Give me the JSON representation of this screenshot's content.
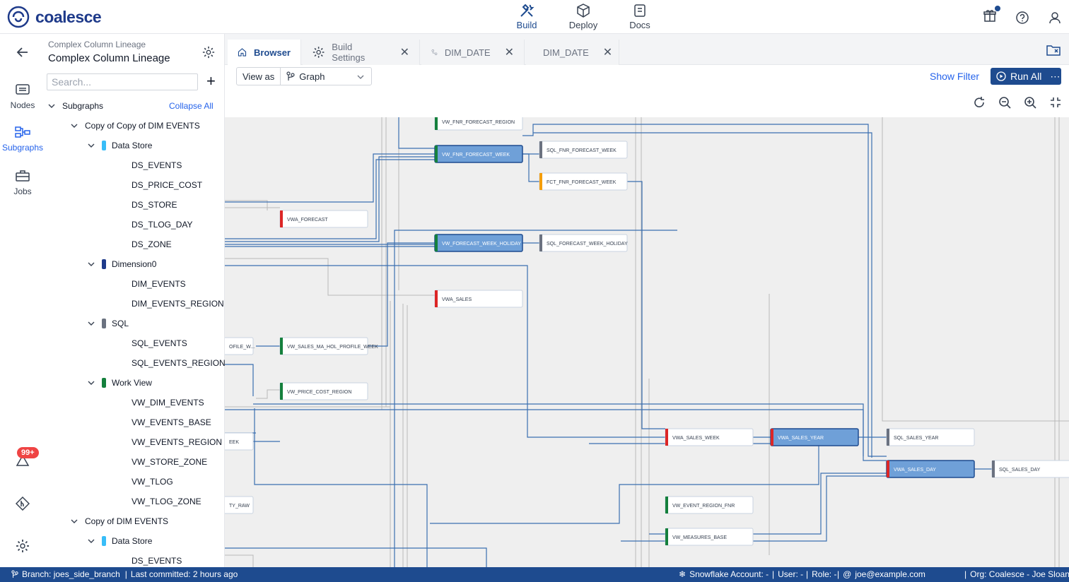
{
  "brand": {
    "name": "coalesce"
  },
  "topnav": [
    {
      "label": "Build",
      "icon": "hammer-wrench-icon",
      "active": true
    },
    {
      "label": "Deploy",
      "icon": "box-icon",
      "active": false
    },
    {
      "label": "Docs",
      "icon": "document-icon",
      "active": false
    }
  ],
  "leftrail": {
    "nodes": "Nodes",
    "subgraphs": "Subgraphs",
    "jobs": "Jobs",
    "badge": "99+"
  },
  "panel": {
    "breadcrumb": "Complex Column Lineage",
    "title": "Complex Column Lineage",
    "search_placeholder": "Search...",
    "subgraphs_label": "Subgraphs",
    "collapse_all": "Collapse All",
    "tree": [
      {
        "label": "Copy of Copy of DIM EVENTS",
        "level": 1
      },
      {
        "label": "Data Store",
        "level": 2,
        "color": "#38bdf8"
      },
      {
        "label": "DS_EVENTS",
        "level": 3
      },
      {
        "label": "DS_PRICE_COST",
        "level": 3
      },
      {
        "label": "DS_STORE",
        "level": 3
      },
      {
        "label": "DS_TLOG_DAY",
        "level": 3
      },
      {
        "label": "DS_ZONE",
        "level": 3
      },
      {
        "label": "Dimension0",
        "level": 2,
        "color": "#1e3a8a"
      },
      {
        "label": "DIM_EVENTS",
        "level": 3
      },
      {
        "label": "DIM_EVENTS_REGION",
        "level": 3
      },
      {
        "label": "SQL",
        "level": 2,
        "color": "#6b7280"
      },
      {
        "label": "SQL_EVENTS",
        "level": 3
      },
      {
        "label": "SQL_EVENTS_REGION",
        "level": 3
      },
      {
        "label": "Work View",
        "level": 2,
        "color": "#15803d"
      },
      {
        "label": "VW_DIM_EVENTS",
        "level": 3
      },
      {
        "label": "VW_EVENTS_BASE",
        "level": 3
      },
      {
        "label": "VW_EVENTS_REGION",
        "level": 3
      },
      {
        "label": "VW_STORE_ZONE",
        "level": 3
      },
      {
        "label": "VW_TLOG",
        "level": 3
      },
      {
        "label": "VW_TLOG_ZONE",
        "level": 3
      },
      {
        "label": "Copy of DIM EVENTS",
        "level": 1
      },
      {
        "label": "Data Store",
        "level": 2,
        "color": "#38bdf8"
      },
      {
        "label": "DS_EVENTS",
        "level": 3
      }
    ]
  },
  "tabs": [
    {
      "label": "Browser",
      "active": true
    },
    {
      "label": "Build Settings",
      "active": false
    },
    {
      "label": "DIM_DATE",
      "active": false
    },
    {
      "label": "DIM_DATE",
      "active": false
    }
  ],
  "toolbar": {
    "view_as": "View as",
    "view_value": "Graph",
    "show_filter": "Show Filter",
    "run_all": "Run All"
  },
  "graph_nodes": [
    {
      "label": "VW_FNR_FORECAST_REGION",
      "color": "#15803d",
      "selected": false
    },
    {
      "label": "VW_FNR_FORECAST_WEEK",
      "color": "#15803d",
      "selected": true
    },
    {
      "label": "SQL_FNR_FORECAST_WEEK",
      "color": "#6b7280",
      "selected": false
    },
    {
      "label": "FCT_FNR_FORECAST_WEEK",
      "color": "#f59e0b",
      "selected": false
    },
    {
      "label": "VWA_FORECAST",
      "color": "#dc2626",
      "selected": false
    },
    {
      "label": "VW_FORECAST_WEEK_HOLIDAY",
      "color": "#15803d",
      "selected": true
    },
    {
      "label": "SQL_FORECAST_WEEK_HOLIDAY",
      "color": "#6b7280",
      "selected": false
    },
    {
      "label": "VWA_SALES",
      "color": "#dc2626",
      "selected": false
    },
    {
      "label": "OFILE_W...",
      "color": "#15803d",
      "selected": false
    },
    {
      "label": "VW_SALES_MA_HOL_PROFILE_WEEK",
      "color": "#15803d",
      "selected": false
    },
    {
      "label": "VW_PRICE_COST_REGION",
      "color": "#15803d",
      "selected": false
    },
    {
      "label": "EEK",
      "color": "#15803d",
      "selected": false
    },
    {
      "label": "VWA_SALES_WEEK",
      "color": "#dc2626",
      "selected": false
    },
    {
      "label": "VWA_SALES_YEAR",
      "color": "#dc2626",
      "selected": true
    },
    {
      "label": "SQL_SALES_YEAR",
      "color": "#6b7280",
      "selected": false
    },
    {
      "label": "VWA_SALES_DAY",
      "color": "#dc2626",
      "selected": true
    },
    {
      "label": "SQL_SALES_DAY",
      "color": "#6b7280",
      "selected": false
    },
    {
      "label": "TY_RAW",
      "color": "#15803d",
      "selected": false
    },
    {
      "label": "VW_EVENT_REGION_FNR",
      "color": "#15803d",
      "selected": false
    },
    {
      "label": "VW_MEASURES_BASE",
      "color": "#15803d",
      "selected": false
    }
  ],
  "status": {
    "branch": "Branch: joes_side_branch",
    "committed": "Last committed: 2 hours ago",
    "account": "Snowflake Account: -",
    "user": "User: -",
    "role": "Role: -",
    "email": "joe@example.com",
    "org": "Org: Coalesce - Joe Sloan"
  }
}
